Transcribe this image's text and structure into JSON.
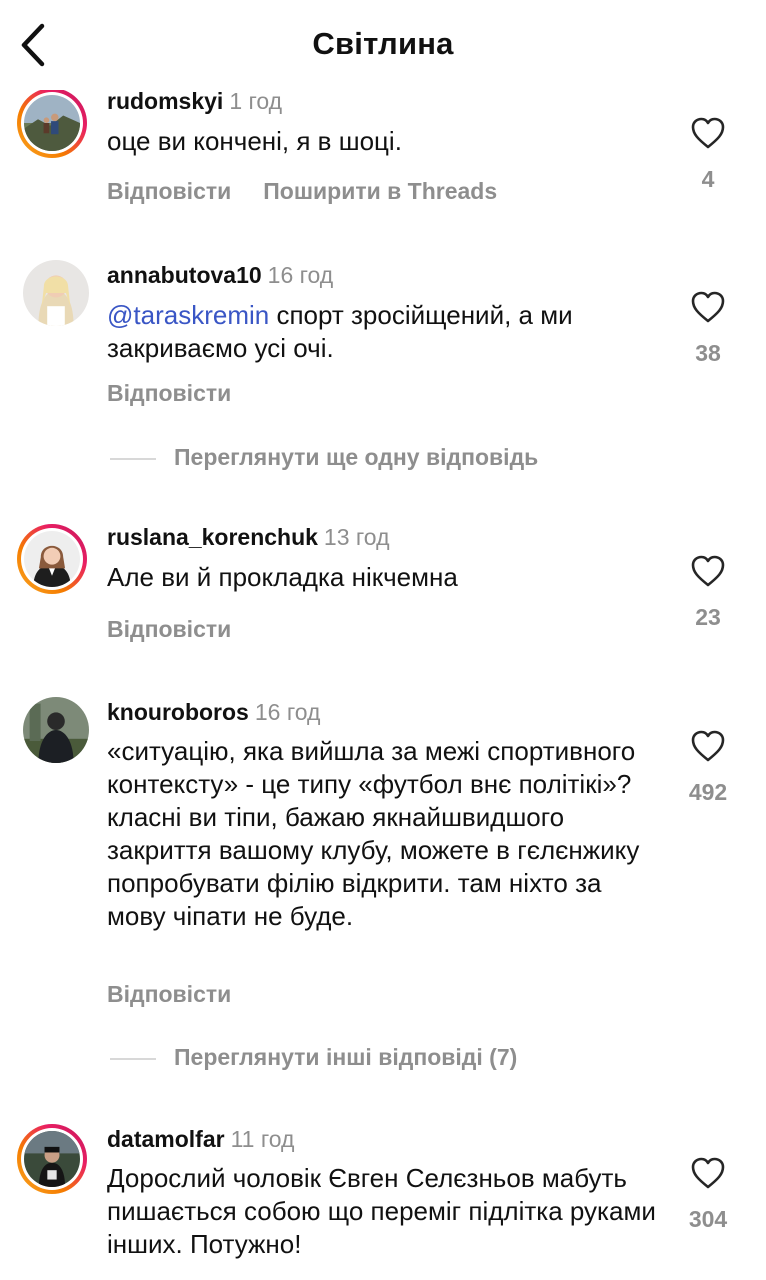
{
  "header": {
    "title": "Світлина"
  },
  "comments": [
    {
      "username": "rudomskyi",
      "time": "1 год",
      "text": "оце ви кончені, я в шоці.",
      "reply_label": "Відповісти",
      "share_label": "Поширити в Threads",
      "likes": "4"
    },
    {
      "username": "annabutova10",
      "time": "16 год",
      "mention": "@taraskremin",
      "text": " спорт зросійщений, а ми закриваємо усі очі.",
      "reply_label": "Відповісти",
      "likes": "38",
      "view_replies": "Переглянути ще одну відповідь"
    },
    {
      "username": "ruslana_korenchuk",
      "time": "13 год",
      "text": "Але ви й прокладка нікчемна",
      "reply_label": "Відповісти",
      "likes": "23"
    },
    {
      "username": "knouroboros",
      "time": "16 год",
      "text": "«ситуацію, яка вийшла за межі спортивного контексту» - це типу «футбол внє політікі»? класні ви тіпи, бажаю якнайшвидшого закриття вашому клубу, можете в гєлєнжику попробувати філію відкрити. там ніхто за мову чіпати не буде.",
      "reply_label": "Відповісти",
      "likes": "492",
      "view_replies": "Переглянути інші відповіді (7)"
    },
    {
      "username": "datamolfar",
      "time": "11 год",
      "text": "Дорослий чоловік Євген Селєзньов мабуть пишається собою що переміг підлітка руками інших. Потужно!",
      "likes": "304"
    }
  ],
  "icons": {
    "back": "chevron-left-icon",
    "like": "heart-outline-icon"
  },
  "colors": {
    "muted": "#8e8e8e",
    "mention": "#3a56c5",
    "story_ring_start": "#f9a825",
    "story_ring_end": "#c2185b"
  }
}
